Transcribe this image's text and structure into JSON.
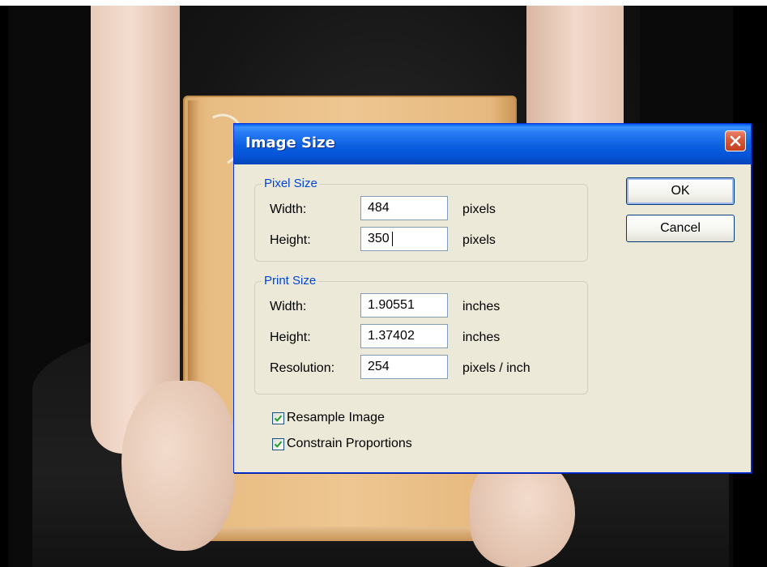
{
  "dialog": {
    "title": "Image Size",
    "close_icon": "close-icon",
    "ok_label": "OK",
    "cancel_label": "Cancel",
    "pixel_size": {
      "title": "Pixel Size",
      "width_label": "Width:",
      "width_value": "484",
      "width_unit": "pixels",
      "height_label": "Height:",
      "height_value": "350",
      "height_unit": "pixels"
    },
    "print_size": {
      "title": "Print Size",
      "width_label": "Width:",
      "width_value": "1.90551",
      "width_unit": "inches",
      "height_label": "Height:",
      "height_value": "1.37402",
      "height_unit": "inches",
      "resolution_label": "Resolution:",
      "resolution_value": "254",
      "resolution_unit": "pixels / inch"
    },
    "options": {
      "resample_label": "Resample Image",
      "resample_checked": true,
      "constrain_label": "Constrain Proportions",
      "constrain_checked": true
    }
  },
  "colors": {
    "title_bar": "#0a5fe0",
    "group_title": "#0046d5",
    "dialog_bg": "#ece9d8",
    "close_button": "#d9573b",
    "checkmark": "#21a121"
  }
}
